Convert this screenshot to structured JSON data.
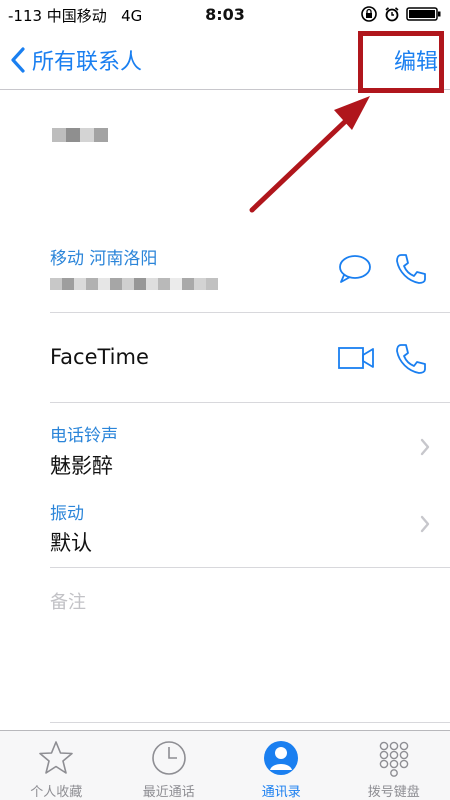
{
  "status_bar": {
    "carrier": "-113 中国移动   4G",
    "time": "8:03"
  },
  "nav": {
    "back_label": "所有联系人",
    "edit_label": "编辑"
  },
  "phone": {
    "label": "移动  河南洛阳"
  },
  "facetime": {
    "label": "FaceTime"
  },
  "ringtone": {
    "label": "电话铃声",
    "value": "魅影醉"
  },
  "vibration": {
    "label": "振动",
    "value": "默认"
  },
  "notes": {
    "placeholder": "备注"
  },
  "tabs": [
    {
      "label": "个人收藏",
      "icon": "star-icon",
      "active": false
    },
    {
      "label": "最近通话",
      "icon": "clock-icon",
      "active": false
    },
    {
      "label": "通讯录",
      "icon": "person-icon",
      "active": true
    },
    {
      "label": "拨号键盘",
      "icon": "keypad-icon",
      "active": false
    }
  ],
  "colors": {
    "accent": "#1a7ff0",
    "label_blue": "#2b85d9",
    "annotation_red": "#b0161c",
    "separator": "#d8d8dc"
  }
}
